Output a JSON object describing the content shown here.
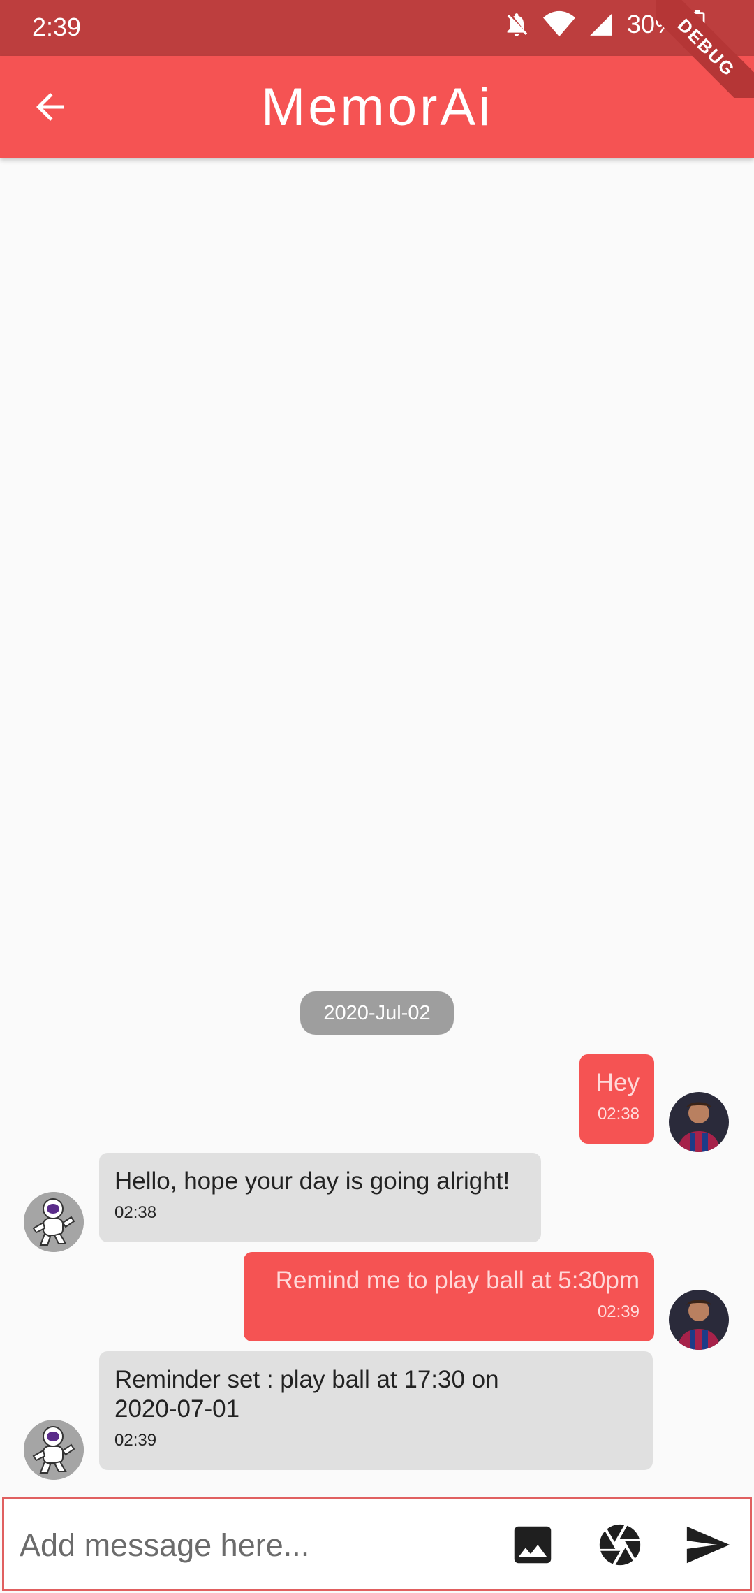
{
  "status_bar": {
    "time": "2:39",
    "battery": "30%",
    "icons": [
      "bell-off-icon",
      "wifi-icon",
      "cell-signal-icon",
      "battery-icon"
    ]
  },
  "app_bar": {
    "title": "MemorAi",
    "back_icon": "arrow-back-icon",
    "debug_banner": "DEBUG",
    "color": "#f55353"
  },
  "chat": {
    "date_chip": "2020-Jul-02",
    "messages": [
      {
        "sender": "user",
        "text": "Hey",
        "time": "02:38"
      },
      {
        "sender": "bot",
        "text": "Hello, hope your day is going alright!",
        "time": "02:38"
      },
      {
        "sender": "user",
        "text": "Remind me to play ball at 5:30pm",
        "time": "02:39"
      },
      {
        "sender": "bot",
        "text": "Reminder set : play ball at 17:30 on 2020-07-01",
        "time": "02:39"
      }
    ]
  },
  "input": {
    "placeholder": "Add message here...",
    "value": "",
    "icons": [
      "image-icon",
      "camera-aperture-icon",
      "send-icon"
    ]
  }
}
